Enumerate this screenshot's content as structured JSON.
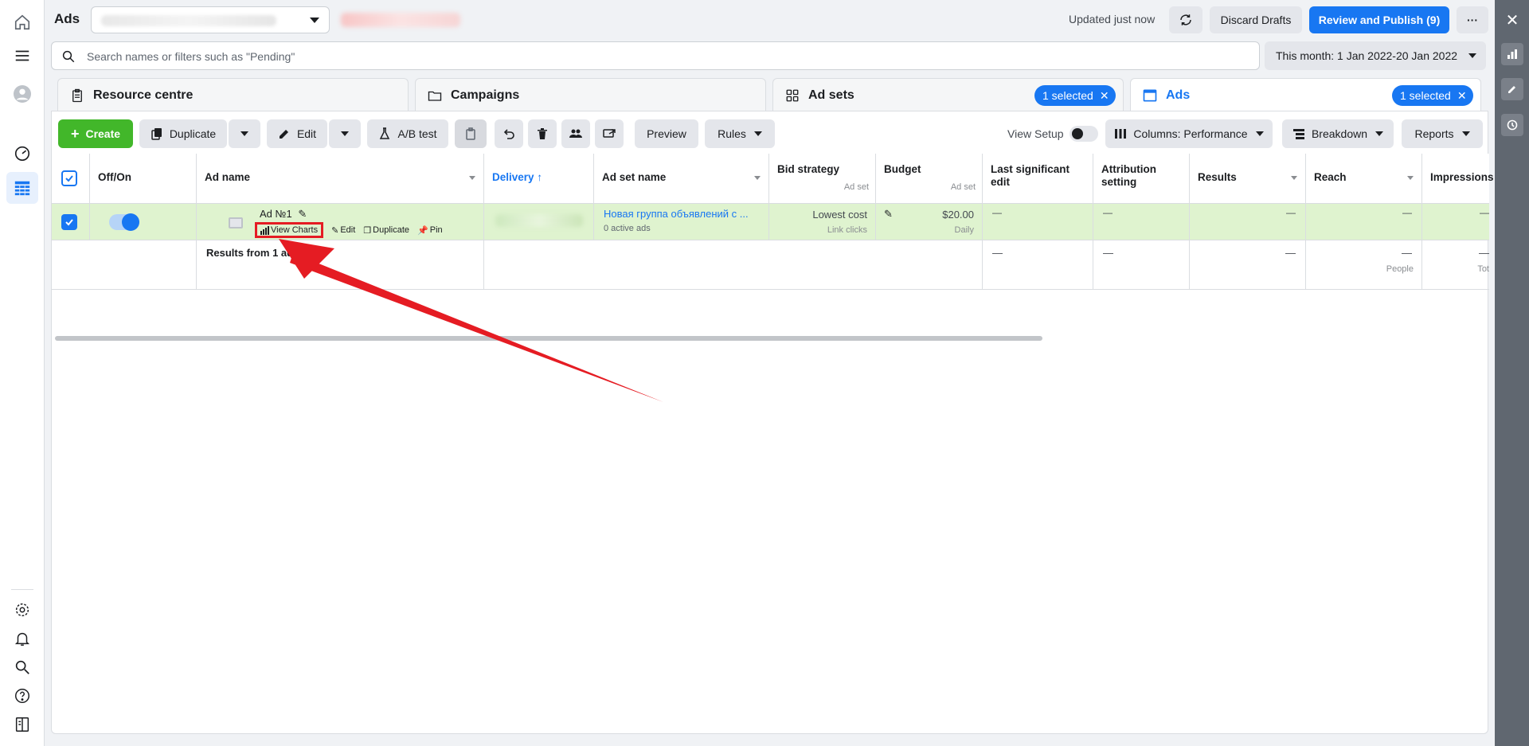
{
  "header": {
    "title": "Ads",
    "updated": "Updated just now",
    "discard_label": "Discard Drafts",
    "review_label": "Review and Publish (9)",
    "more_label": "···"
  },
  "search": {
    "placeholder": "Search names or filters such as \"Pending\""
  },
  "date_range": "This month: 1 Jan 2022-20 Jan 2022",
  "tabs": [
    {
      "label": "Resource centre",
      "icon": "clipboard-icon"
    },
    {
      "label": "Campaigns",
      "icon": "folder-icon"
    },
    {
      "label": "Ad sets",
      "icon": "grid-icon",
      "chip": "1 selected"
    },
    {
      "label": "Ads",
      "icon": "ad-icon",
      "chip": "1 selected"
    }
  ],
  "toolbar": {
    "create": "Create",
    "duplicate": "Duplicate",
    "edit": "Edit",
    "ab_test": "A/B test",
    "preview": "Preview",
    "rules": "Rules",
    "view_setup": "View Setup",
    "columns": "Columns: Performance",
    "breakdown": "Breakdown",
    "reports": "Reports"
  },
  "table": {
    "headers": {
      "off_on": "Off/On",
      "ad_name": "Ad name",
      "delivery": "Delivery ↑",
      "ad_set_name": "Ad set name",
      "bid_strategy": "Bid strategy",
      "bid_sub": "Ad set",
      "budget": "Budget",
      "budget_sub": "Ad set",
      "last_edit": "Last significant edit",
      "attribution": "Attribution setting",
      "results": "Results",
      "reach": "Reach",
      "impressions": "Impressions"
    },
    "row": {
      "ad_name": "Ad №1",
      "action_view_charts": "View Charts",
      "action_edit": "Edit",
      "action_duplicate": "Duplicate",
      "action_pin": "Pin",
      "ad_set_name": "Новая группа объявлений с ...",
      "ad_set_sub": "0 active ads",
      "bid_strategy": "Lowest cost",
      "bid_sub": "Link clicks",
      "budget": "$20.00",
      "budget_sub": "Daily",
      "dash": "—"
    },
    "summary": {
      "label": "Results from 1 ad",
      "dash": "—",
      "reach_sub": "People",
      "impressions_sub": "Tot"
    }
  },
  "colors": {
    "accent": "#1877f2",
    "create": "#42b72a",
    "selected_row": "#dff3cf",
    "highlight": "#e51c23"
  }
}
